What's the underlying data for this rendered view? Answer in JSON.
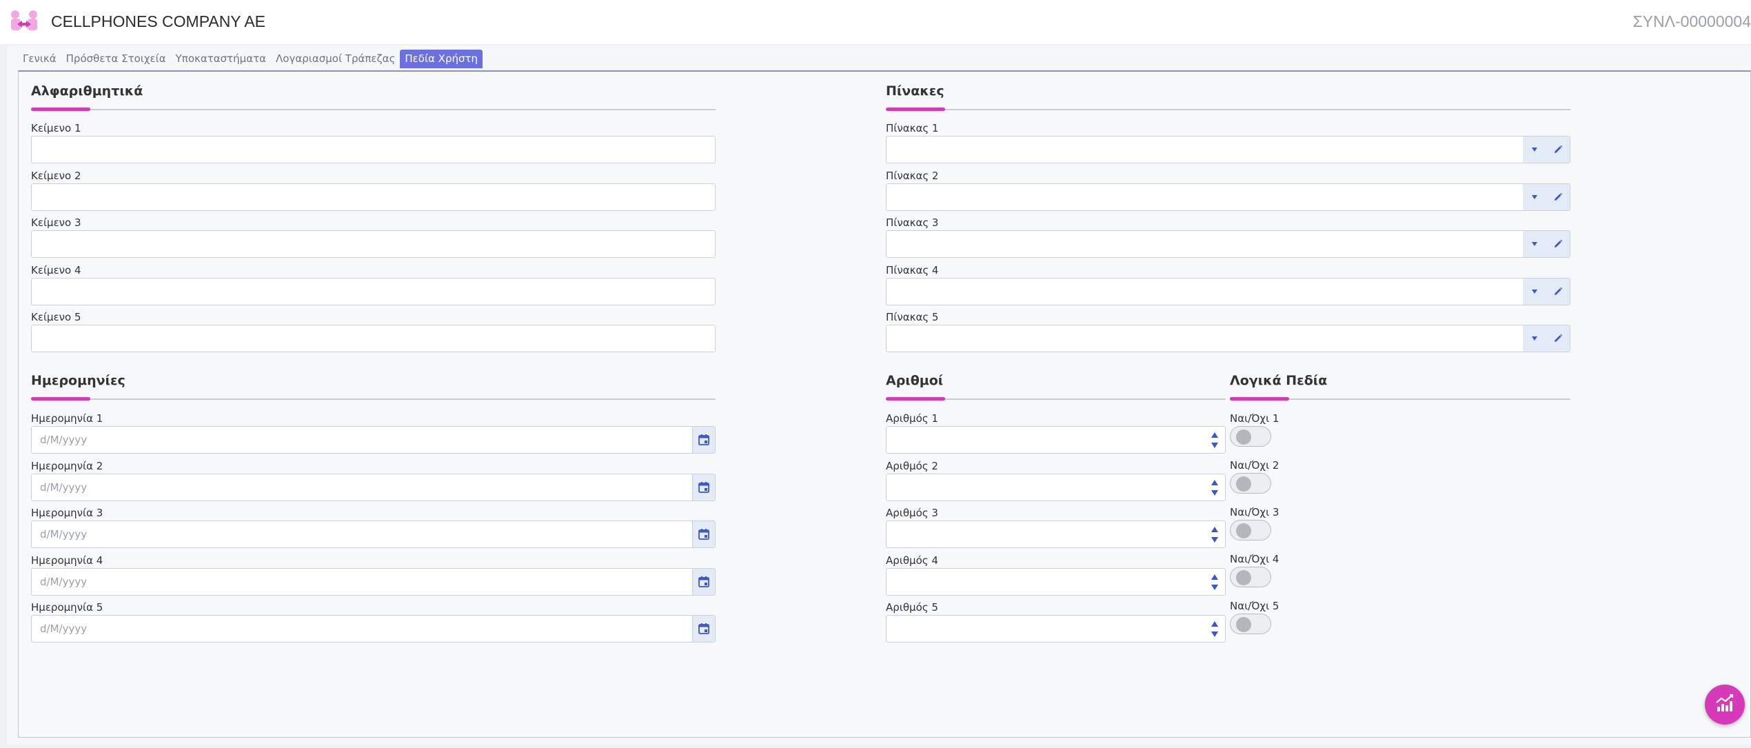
{
  "header": {
    "company_name": "CELLPHONES COMPANY AE",
    "document_code": "ΣΥΝΛ-00000004"
  },
  "tabs": [
    {
      "label": "Γενικά"
    },
    {
      "label": "Πρόσθετα Στοιχεία"
    },
    {
      "label": "Υποκαταστήματα"
    },
    {
      "label": "Λογαριασμοί Τράπεζας"
    },
    {
      "label": "Πεδία Χρήστη",
      "active": true
    }
  ],
  "sections": {
    "alphanumeric": {
      "title": "Αλφαριθμητικά",
      "fields": [
        "Κείμενο 1",
        "Κείμενο 2",
        "Κείμενο 3",
        "Κείμενο 4",
        "Κείμενο 5"
      ]
    },
    "tables": {
      "title": "Πίνακες",
      "fields": [
        "Πίνακας 1",
        "Πίνακας 2",
        "Πίνακας 3",
        "Πίνακας 4",
        "Πίνακας 5"
      ]
    },
    "dates": {
      "title": "Ημερομηνίες",
      "placeholder": "d/M/yyyy",
      "fields": [
        "Ημερομηνία 1",
        "Ημερομηνία 2",
        "Ημερομηνία 3",
        "Ημερομηνία 4",
        "Ημερομηνία 5"
      ]
    },
    "numbers": {
      "title": "Αριθμοί",
      "fields": [
        "Αριθμός 1",
        "Αριθμός 2",
        "Αριθμός 3",
        "Αριθμός 4",
        "Αριθμός 5"
      ]
    },
    "booleans": {
      "title": "Λογικά Πεδία",
      "fields": [
        "Ναι/Όχι 1",
        "Ναι/Όχι 2",
        "Ναι/Όχι 3",
        "Ναι/Όχι 4",
        "Ναι/Όχι 5"
      ],
      "values": [
        false,
        false,
        false,
        false,
        false
      ]
    }
  },
  "colors": {
    "accent": "#d63ab8",
    "active_tab": "#6c6fe0",
    "icon_blue": "#3e56c8"
  },
  "icons": {
    "dropdown": "chevron-down-icon",
    "edit": "pencil-icon",
    "calendar": "calendar-icon",
    "fab": "chart-icon"
  }
}
